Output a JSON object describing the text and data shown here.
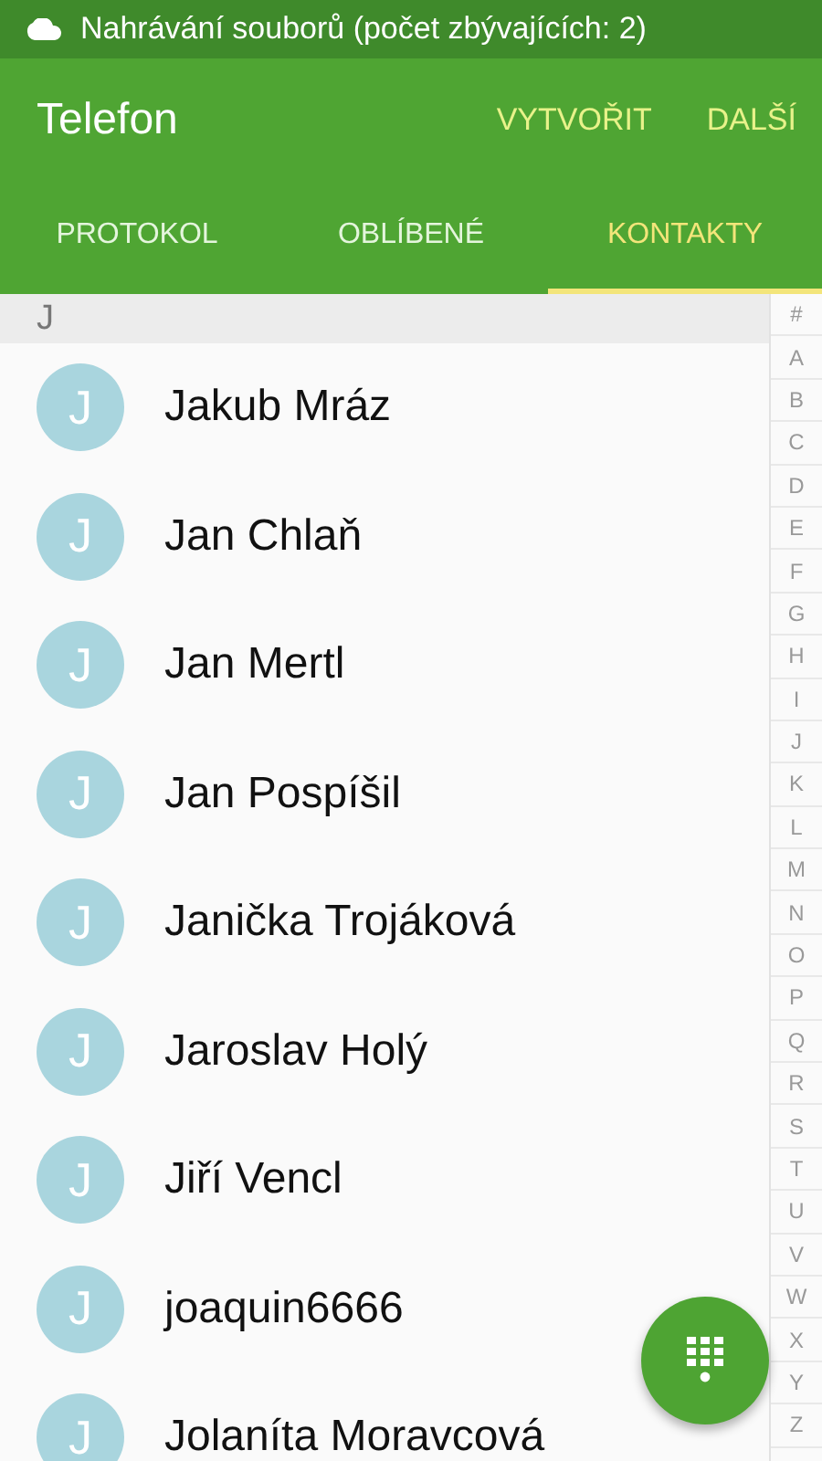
{
  "status_bar": {
    "notification": "Nahrávání souborů (počet zbývajících: 2)"
  },
  "app_bar": {
    "title": "Telefon",
    "actions": [
      "VYTVOŘIT",
      "DALŠÍ"
    ]
  },
  "tabs": [
    {
      "label": "PROTOKOL",
      "selected": false
    },
    {
      "label": "OBLÍBENÉ",
      "selected": false
    },
    {
      "label": "KONTAKTY",
      "selected": true
    }
  ],
  "section_header": "J",
  "contacts": [
    {
      "initial": "J",
      "name": "Jakub Mráz"
    },
    {
      "initial": "J",
      "name": "Jan Chlaň"
    },
    {
      "initial": "J",
      "name": "Jan Mertl"
    },
    {
      "initial": "J",
      "name": "Jan Pospíšil"
    },
    {
      "initial": "J",
      "name": "Janička Trojáková"
    },
    {
      "initial": "J",
      "name": "Jaroslav Holý"
    },
    {
      "initial": "J",
      "name": "Jiří Vencl"
    },
    {
      "initial": "J",
      "name": "joaquin6666"
    },
    {
      "initial": "J",
      "name": "Jolaníta Moravcová"
    }
  ],
  "index": [
    "#",
    "A",
    "B",
    "C",
    "D",
    "E",
    "F",
    "G",
    "H",
    "I",
    "J",
    "K",
    "L",
    "M",
    "N",
    "O",
    "P",
    "Q",
    "R",
    "S",
    "T",
    "U",
    "V",
    "W",
    "X",
    "Y",
    "Z"
  ]
}
